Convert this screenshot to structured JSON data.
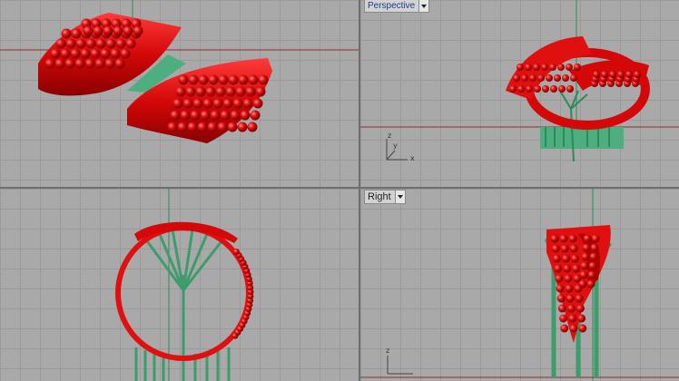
{
  "viewports": {
    "top_left": {
      "title": ""
    },
    "top_right": {
      "title": "Perspective",
      "axis_x": "x",
      "axis_y": "y",
      "axis_z": "z"
    },
    "bottom_left": {
      "title": ""
    },
    "bottom_right": {
      "title": "Right",
      "axis_z": "z"
    }
  },
  "colors": {
    "model_red": "#e01010",
    "support_green": "#4fae7f",
    "grid": "#9a9a9a",
    "background": "#a9a9a9"
  },
  "icons": {
    "viewport_menu": "chevron-down-icon"
  }
}
